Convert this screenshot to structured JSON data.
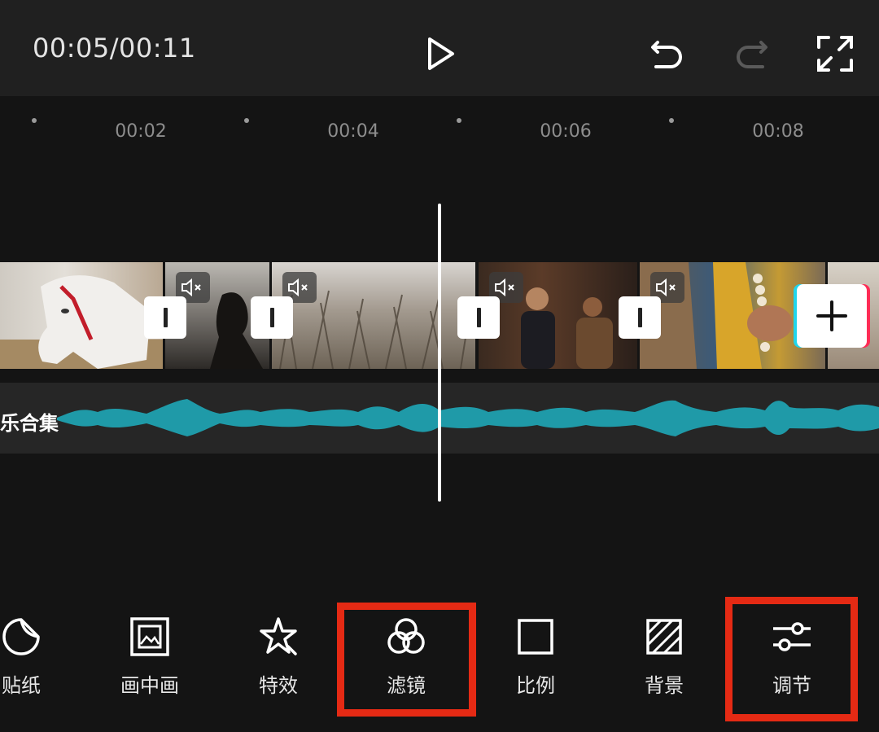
{
  "topbar": {
    "time": "00:05/00:11"
  },
  "ruler": {
    "ticks": [
      "00:02",
      "00:04",
      "00:06",
      "00:08"
    ]
  },
  "audio": {
    "label": "乐合集"
  },
  "toolbar": {
    "items": [
      {
        "label": "贴纸",
        "icon": "sticker-icon"
      },
      {
        "label": "画中画",
        "icon": "picture-in-picture-icon"
      },
      {
        "label": "特效",
        "icon": "effects-star-icon"
      },
      {
        "label": "滤镜",
        "icon": "filter-icon"
      },
      {
        "label": "比例",
        "icon": "ratio-icon"
      },
      {
        "label": "背景",
        "icon": "background-icon"
      },
      {
        "label": "调节",
        "icon": "adjust-icon"
      }
    ]
  },
  "colors": {
    "highlight": "#e52a14",
    "waveform": "#1f9aa8",
    "background": "#141414"
  }
}
